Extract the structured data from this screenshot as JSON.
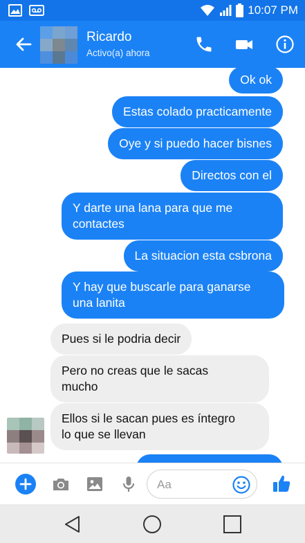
{
  "status_bar": {
    "time": "10:07 PM",
    "icons": [
      "image-icon",
      "voicemail-icon",
      "wifi-icon",
      "signal-icon",
      "battery-icon"
    ]
  },
  "header": {
    "contact_name": "Ricardo",
    "status": "Activo(a) ahora",
    "actions": [
      "phone-icon",
      "video-icon",
      "info-icon"
    ]
  },
  "messages": [
    {
      "from": "me",
      "lines": [
        "Ok ok"
      ]
    },
    {
      "from": "me",
      "lines": [
        "Estas colado practicamente"
      ]
    },
    {
      "from": "me",
      "lines": [
        "Oye y si puedo hacer bisnes"
      ]
    },
    {
      "from": "me",
      "lines": [
        "Directos con el"
      ]
    },
    {
      "from": "me",
      "lines": [
        "Y darte una lana para que me",
        "contactes"
      ]
    },
    {
      "from": "me",
      "lines": [
        "La situacion esta csbrona"
      ]
    },
    {
      "from": "me",
      "lines": [
        "Y hay que buscarle para ganarse",
        "una lanita"
      ]
    },
    {
      "from": "them",
      "lines": [
        "Pues si le podria decir"
      ]
    },
    {
      "from": "them",
      "lines": [
        "Pero no creas que le sacas",
        "mucho"
      ]
    },
    {
      "from": "them",
      "lines": [
        "Ellos si le sacan pues es íntegro",
        "lo que se llevan"
      ]
    }
  ],
  "composer": {
    "placeholder": "Aa",
    "tools": [
      "plus-icon",
      "camera-icon",
      "gallery-icon",
      "microphone-icon",
      "emoji-icon",
      "like-icon"
    ]
  },
  "colors": {
    "accent": "#1b82f5",
    "status_bar": "#1274e8",
    "incoming_bubble": "#eeeeee",
    "navbar": "#ebebeb"
  }
}
